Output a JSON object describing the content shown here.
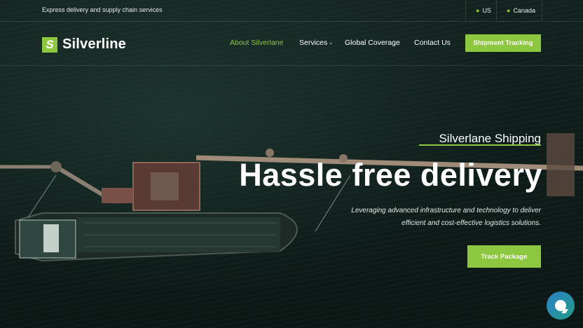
{
  "topbar": {
    "tagline": "Express delivery and supply chain services",
    "locations": [
      {
        "label": "US"
      },
      {
        "label": "Canada"
      }
    ]
  },
  "brand": {
    "logo_mark": "S",
    "name": "Silverline"
  },
  "nav": {
    "items": [
      {
        "label": "About Silverlane",
        "active": true
      },
      {
        "label": "Services",
        "has_dropdown": true
      },
      {
        "label": "Global Coverage"
      },
      {
        "label": "Contact Us"
      }
    ],
    "cta_label": "Shipment Tracking"
  },
  "hero": {
    "eyebrow": "Silverlane Shipping",
    "headline": "Hassle free delivery",
    "subtext": "Leveraging advanced infrastructure and technology to deliver efficient and cost-effective logistics solutions.",
    "cta_label": "Track Package"
  },
  "colors": {
    "accent": "#8dc63f",
    "background": "#0d1a17"
  },
  "icons": {
    "location": "map-pin-icon",
    "chat": "chat-bubble-icon",
    "dropdown": "chevron-down-icon"
  }
}
